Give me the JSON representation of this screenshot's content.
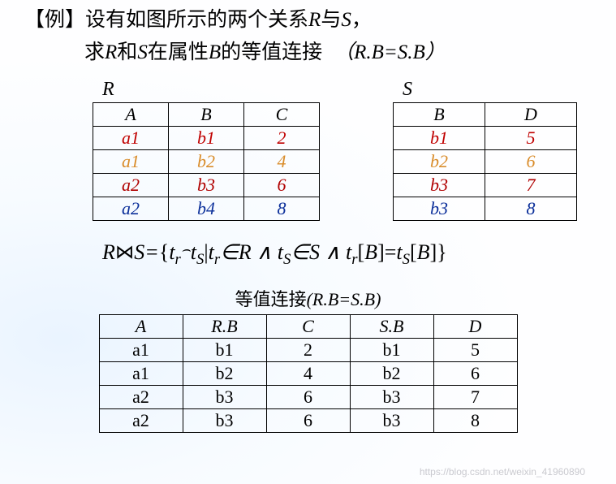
{
  "title": {
    "prefix": "【例】",
    "line1_a": "设有如图所示的两个关系",
    "R": "R",
    "and1": "与",
    "S": "S",
    "comma": "，",
    "line2_a": "求",
    "line2_b": "和",
    "line2_c": "在属性",
    "B": "B",
    "line2_d": "的等值连接",
    "paren": "（R.B=S.B）"
  },
  "tableR": {
    "name": "R",
    "headers": [
      "A",
      "B",
      "C"
    ],
    "rows": [
      {
        "cells": [
          "a1",
          "b1",
          "2"
        ],
        "cls": "c-a1a"
      },
      {
        "cells": [
          "a1",
          "b2",
          "4"
        ],
        "cls": "c-a1b"
      },
      {
        "cells": [
          "a2",
          "b3",
          "6"
        ],
        "cls": "c-darkred"
      },
      {
        "cells": [
          "a2",
          "b4",
          "8"
        ],
        "cls": "c-a2"
      }
    ]
  },
  "tableS": {
    "name": "S",
    "headers": [
      "B",
      "D"
    ],
    "rows": [
      {
        "cells": [
          "b1",
          "5"
        ],
        "cls": "c-a1a"
      },
      {
        "cells": [
          "b2",
          "6"
        ],
        "cls": "c-a1b"
      },
      {
        "cells": [
          "b3",
          "7"
        ],
        "cls": "c-darkred"
      },
      {
        "cells": [
          "b3",
          "8"
        ],
        "cls": "c-blue"
      }
    ]
  },
  "formula": {
    "lhsR": "R",
    "bowtie": "⋈",
    "lhsS": "S",
    "eq": "=",
    "open": "{",
    "tr": "t",
    "rsub": "r",
    "frown": "⌢",
    "ts": "t",
    "ssub": "S",
    "bar": "|",
    "in": "∈",
    "and": " ∧ ",
    "brL": "[",
    "brR": "]",
    "B": "B",
    "close": "}"
  },
  "tableJoin": {
    "caption_a": "等值连接",
    "caption_b": "(R.B=S.B)",
    "headers": [
      "A",
      "R.B",
      "C",
      "S.B",
      "D"
    ],
    "rows": [
      [
        "a1",
        "b1",
        "2",
        "b1",
        "5"
      ],
      [
        "a1",
        "b2",
        "4",
        "b2",
        "6"
      ],
      [
        "a2",
        "b3",
        "6",
        "b3",
        "7"
      ],
      [
        "a2",
        "b3",
        "6",
        "b3",
        "8"
      ]
    ]
  },
  "watermark": "https://blog.csdn.net/weixin_41960890"
}
